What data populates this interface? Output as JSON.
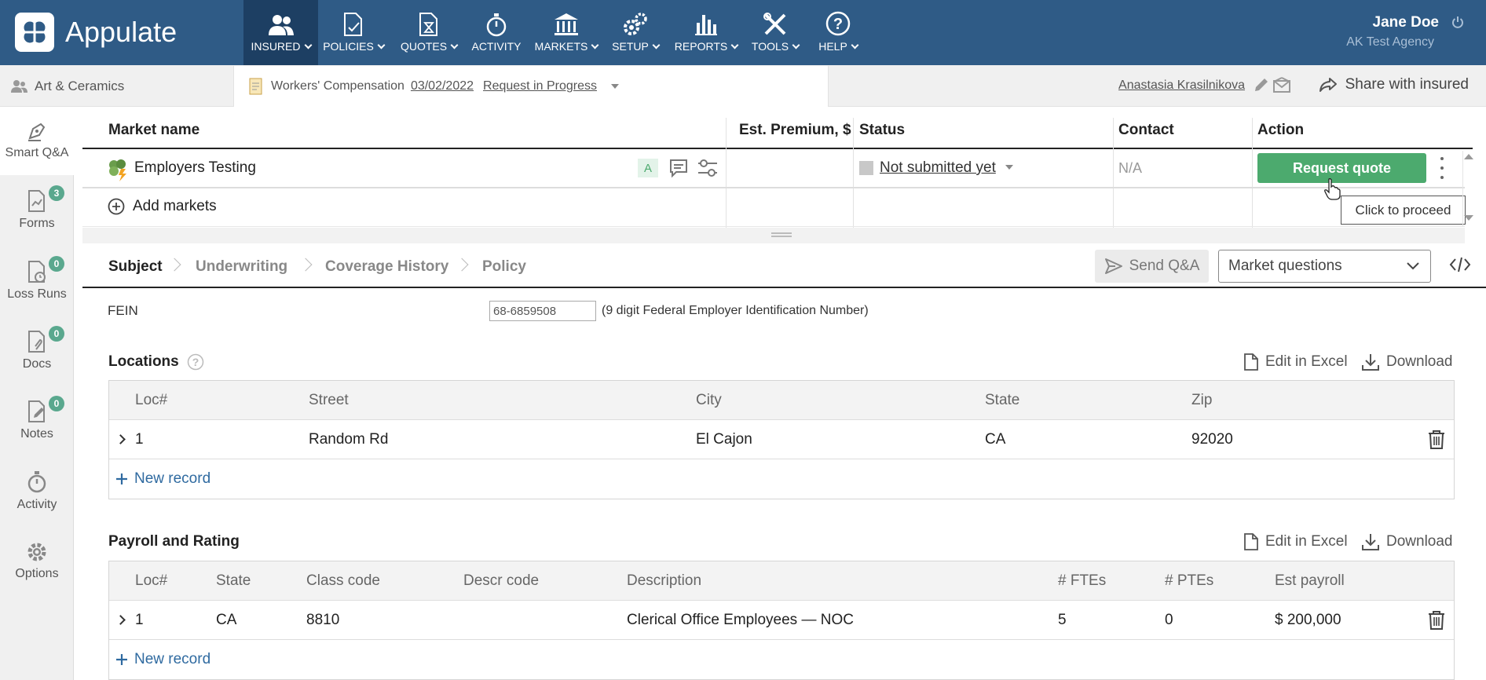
{
  "app": {
    "name": "Appulate",
    "user_name": "Jane Doe",
    "user_agency": "AK Test Agency"
  },
  "nav": [
    {
      "label": "INSURED",
      "icon": "users-icon"
    },
    {
      "label": "POLICIES",
      "icon": "document-check-icon"
    },
    {
      "label": "QUOTES",
      "icon": "document-hourglass-icon"
    },
    {
      "label": "ACTIVITY",
      "icon": "stopwatch-icon"
    },
    {
      "label": "MARKETS",
      "icon": "bank-icon"
    },
    {
      "label": "SETUP",
      "icon": "gears-icon"
    },
    {
      "label": "REPORTS",
      "icon": "bar-chart-icon"
    },
    {
      "label": "TOOLS",
      "icon": "tools-icon"
    },
    {
      "label": "HELP",
      "icon": "help-icon"
    }
  ],
  "subbar": {
    "insured": "Art & Ceramics",
    "policy_type": "Workers' Compensation",
    "policy_date": "03/02/2022",
    "policy_status": "Request in Progress",
    "underwriter": "Anastasia Krasilnikova",
    "share": "Share with insured"
  },
  "sidebar": [
    {
      "label": "Smart Q&A",
      "badge": ""
    },
    {
      "label": "Forms",
      "badge": "3"
    },
    {
      "label": "Loss Runs",
      "badge": "0"
    },
    {
      "label": "Docs",
      "badge": "0"
    },
    {
      "label": "Notes",
      "badge": "0"
    },
    {
      "label": "Activity",
      "badge": ""
    },
    {
      "label": "Options",
      "badge": ""
    }
  ],
  "markets": {
    "columns": [
      "Market name",
      "Est. Premium, $",
      "Status",
      "Contact",
      "Action"
    ],
    "row": {
      "name": "Employers Testing",
      "badge": "A",
      "premium": "",
      "status": "Not submitted yet",
      "contact": "N/A",
      "action": "Request quote"
    },
    "tooltip": "Click to proceed",
    "add_markets": "Add markets"
  },
  "tabs": [
    "Subject",
    "Underwriting",
    "Coverage History",
    "Policy"
  ],
  "send_qa": "Send Q&A",
  "market_questions": "Market questions",
  "fein": {
    "label": "FEIN",
    "value": "68-6859508",
    "hint": "(9 digit Federal Employer Identification Number)"
  },
  "locations": {
    "title": "Locations",
    "edit_excel": "Edit in Excel",
    "download": "Download",
    "columns": [
      "Loc#",
      "Street",
      "City",
      "State",
      "Zip"
    ],
    "rows": [
      [
        "1",
        "Random Rd",
        "El Cajon",
        "CA",
        "92020"
      ]
    ],
    "new_record": "New record"
  },
  "payroll": {
    "title": "Payroll and Rating",
    "edit_excel": "Edit in Excel",
    "download": "Download",
    "columns": [
      "Loc#",
      "State",
      "Class code",
      "Descr code",
      "Description",
      "# FTEs",
      "# PTEs",
      "Est payroll"
    ],
    "rows": [
      [
        "1",
        "CA",
        "8810",
        "",
        "Clerical Office Employees — NOC",
        "5",
        "0",
        "$ 200,000"
      ]
    ],
    "new_record": "New record"
  },
  "colors": {
    "nav_bg": "#2f5b86",
    "nav_active": "#1d3f63",
    "accent_green": "#4caa6e",
    "badge": "#5aa88e",
    "link": "#2f6aa0"
  }
}
